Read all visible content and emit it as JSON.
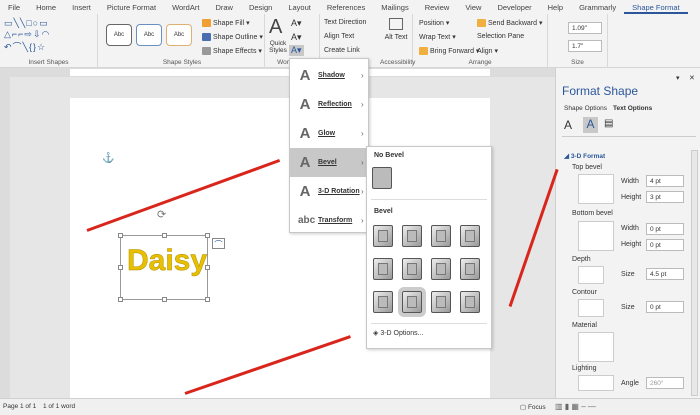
{
  "tabs": [
    "File",
    "Home",
    "Insert",
    "Picture Format",
    "WordArt",
    "Draw",
    "Design",
    "Layout",
    "References",
    "Mailings",
    "Review",
    "View",
    "Developer",
    "Help",
    "Grammarly",
    "Shape Format"
  ],
  "ribbon": {
    "insert_shapes": "Insert Shapes",
    "shape_styles": "Shape Styles",
    "abc": "Abc",
    "shape_fill": "Shape Fill",
    "shape_outline": "Shape Outline",
    "shape_effects": "Shape Effects",
    "quick_styles": "Quick Styles",
    "wordart_styles": "WordArt S",
    "text_direction": "Text Direction",
    "align_text": "Align Text",
    "create_link": "Create Link",
    "alt_text": "Alt Text",
    "accessibility": "Accessibility",
    "position": "Position",
    "wrap_text": "Wrap Text",
    "bring_forward": "Bring Forward",
    "send_backward": "Send Backward",
    "selection_pane": "Selection Pane",
    "align": "Align",
    "arrange": "Arrange",
    "height": "1.09\"",
    "width": "1.7\"",
    "size": "Size"
  },
  "document": {
    "wordart_text": "Daisy"
  },
  "text_effects_menu": [
    {
      "label": "Shadow"
    },
    {
      "label": "Reflection"
    },
    {
      "label": "Glow"
    },
    {
      "label": "Bevel",
      "selected": true
    },
    {
      "label": "3-D Rotation"
    },
    {
      "label": "Transform"
    }
  ],
  "bevel_gallery": {
    "no_bevel": "No Bevel",
    "bevel": "Bevel",
    "options": "3-D Options..."
  },
  "pane": {
    "title": "Format Shape",
    "tab_shape": "Shape Options",
    "tab_text": "Text Options",
    "section": "3-D Format",
    "top_bevel": "Top bevel",
    "bottom_bevel": "Bottom bevel",
    "width_label": "Width",
    "height_label": "Height",
    "top_width": "4 pt",
    "top_height": "3 pt",
    "bottom_width": "0 pt",
    "bottom_height": "0 pt",
    "depth": "Depth",
    "size_label": "Size",
    "depth_size": "4.5 pt",
    "contour": "Contour",
    "contour_size": "0 pt",
    "material": "Material",
    "lighting": "Lighting",
    "angle_label": "Angle",
    "angle": "260°"
  },
  "status": {
    "page": "Page 1 of 1",
    "words": "1 of 1 word",
    "focus": "Focus"
  }
}
